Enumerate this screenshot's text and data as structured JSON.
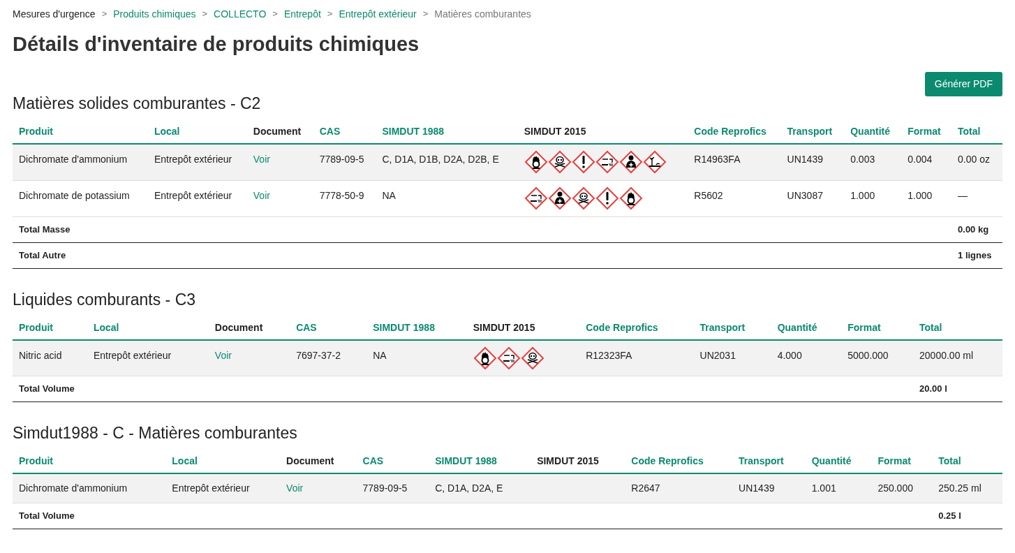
{
  "breadcrumb": {
    "separator": ">",
    "items": [
      {
        "label": "Mesures d'urgence",
        "kind": "root"
      },
      {
        "label": "Produits chimiques",
        "kind": "link"
      },
      {
        "label": "COLLECTO",
        "kind": "link"
      },
      {
        "label": "Entrepôt",
        "kind": "link"
      },
      {
        "label": "Entrepôt extérieur",
        "kind": "link"
      },
      {
        "label": "Matières comburantes",
        "kind": "current"
      }
    ]
  },
  "title": "Détails d'inventaire de produits chimiques",
  "pdf_button": "Générer PDF",
  "sections": [
    {
      "title": "Matières solides comburantes - C2",
      "columns": [
        {
          "label": "Produit",
          "sortable": true
        },
        {
          "label": "Local",
          "sortable": true
        },
        {
          "label": "Document",
          "sortable": false
        },
        {
          "label": "CAS",
          "sortable": true
        },
        {
          "label": "SIMDUT 1988",
          "sortable": true
        },
        {
          "label": "SIMDUT 2015",
          "sortable": false
        },
        {
          "label": "Code Reprofics",
          "sortable": true
        },
        {
          "label": "Transport",
          "sortable": true
        },
        {
          "label": "Quantité",
          "sortable": true
        },
        {
          "label": "Format",
          "sortable": true
        },
        {
          "label": "Total",
          "sortable": true
        }
      ],
      "rows": [
        {
          "produit": "Dichromate d'ammonium",
          "local": "Entrepôt extérieur",
          "document": "Voir",
          "cas": "7789-09-5",
          "simdut_1988": "C, D1A, D1B, D2A, D2B, E",
          "simdut_2015": [
            {
              "kind": "oxidizer"
            },
            {
              "kind": "toxic"
            },
            {
              "kind": "irritant"
            },
            {
              "kind": "corrosive"
            },
            {
              "kind": "health"
            },
            {
              "kind": "environment"
            }
          ],
          "code": "R14963FA",
          "transport": "UN1439",
          "quantite": "0.003",
          "format": "0.004",
          "total": "0.00 oz"
        },
        {
          "produit": "Dichromate de potassium",
          "local": "Entrepôt extérieur",
          "document": "Voir",
          "cas": "7778-50-9",
          "simdut_1988": "NA",
          "simdut_2015": [
            {
              "kind": "corrosive"
            },
            {
              "kind": "health"
            },
            {
              "kind": "toxic"
            },
            {
              "kind": "irritant"
            },
            {
              "kind": "oxidizer"
            }
          ],
          "code": "R5602",
          "transport": "UN3087",
          "quantite": "1.000",
          "format": "1.000",
          "total": "—"
        }
      ],
      "totals": [
        {
          "label": "Total Masse",
          "value": "0.00 kg"
        },
        {
          "label": "Total Autre",
          "value": "1 lignes"
        }
      ]
    },
    {
      "title": "Liquides comburants - C3",
      "columns": [
        {
          "label": "Produit",
          "sortable": true
        },
        {
          "label": "Local",
          "sortable": true
        },
        {
          "label": "Document",
          "sortable": false
        },
        {
          "label": "CAS",
          "sortable": true
        },
        {
          "label": "SIMDUT 1988",
          "sortable": true
        },
        {
          "label": "SIMDUT 2015",
          "sortable": false
        },
        {
          "label": "Code Reprofics",
          "sortable": true
        },
        {
          "label": "Transport",
          "sortable": true
        },
        {
          "label": "Quantité",
          "sortable": true
        },
        {
          "label": "Format",
          "sortable": true
        },
        {
          "label": "Total",
          "sortable": true
        }
      ],
      "rows": [
        {
          "produit": "Nitric acid",
          "local": "Entrepôt extérieur",
          "document": "Voir",
          "cas": "7697-37-2",
          "simdut_1988": "NA",
          "simdut_2015": [
            {
              "kind": "oxidizer"
            },
            {
              "kind": "corrosive"
            },
            {
              "kind": "toxic"
            }
          ],
          "code": "R12323FA",
          "transport": "UN2031",
          "quantite": "4.000",
          "format": "5000.000",
          "total": "20000.00 ml"
        }
      ],
      "totals": [
        {
          "label": "Total Volume",
          "value": "20.00 l"
        }
      ]
    },
    {
      "title": "Simdut1988 - C - Matières comburantes",
      "columns": [
        {
          "label": "Produit",
          "sortable": true
        },
        {
          "label": "Local",
          "sortable": true
        },
        {
          "label": "Document",
          "sortable": false
        },
        {
          "label": "CAS",
          "sortable": true
        },
        {
          "label": "SIMDUT 1988",
          "sortable": true
        },
        {
          "label": "SIMDUT 2015",
          "sortable": false
        },
        {
          "label": "Code Reprofics",
          "sortable": true
        },
        {
          "label": "Transport",
          "sortable": true
        },
        {
          "label": "Quantité",
          "sortable": true
        },
        {
          "label": "Format",
          "sortable": true
        },
        {
          "label": "Total",
          "sortable": true
        }
      ],
      "rows": [
        {
          "produit": "Dichromate d'ammonium",
          "local": "Entrepôt extérieur",
          "document": "Voir",
          "cas": "7789-09-5",
          "simdut_1988": "C, D1A, D2A, E",
          "simdut_2015": [],
          "code": "R2647",
          "transport": "UN1439",
          "quantite": "1.001",
          "format": "250.000",
          "total": "250.25 ml"
        }
      ],
      "totals": [
        {
          "label": "Total Volume",
          "value": "0.25 l"
        }
      ]
    }
  ]
}
